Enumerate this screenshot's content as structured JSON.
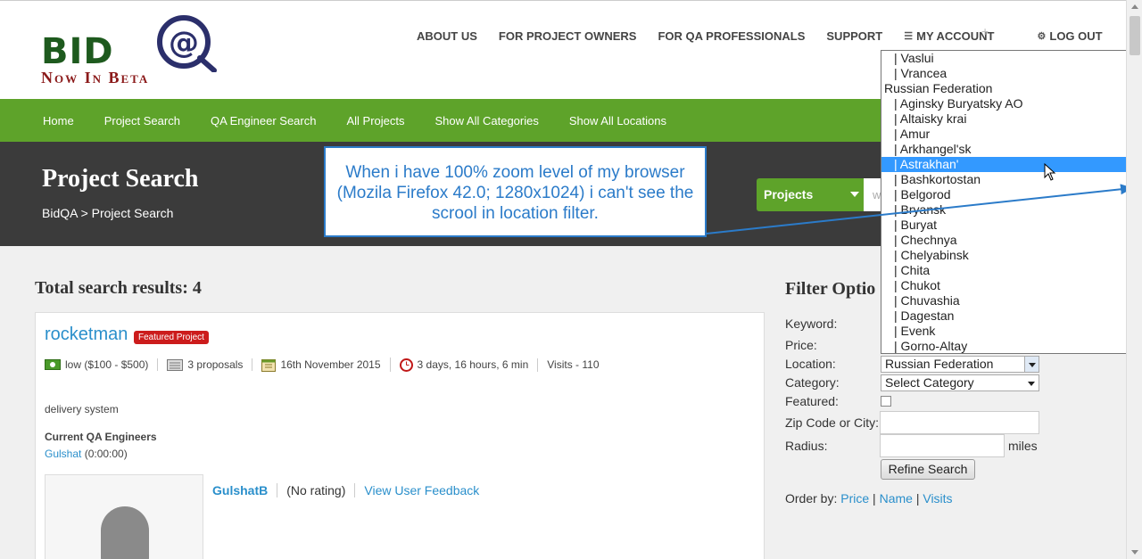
{
  "logo": {
    "main": "BID",
    "at": "@",
    "tagline": "Now In Beta"
  },
  "topnav": {
    "about": "ABOUT US",
    "owners": "FOR PROJECT OWNERS",
    "qa": "FOR QA PROFESSIONALS",
    "support": "SUPPORT",
    "account": "MY ACCOUNT",
    "logout": "LOG OUT",
    "plus": "+"
  },
  "mainnav": [
    "Home",
    "Project Search",
    "QA Engineer Search",
    "All Projects",
    "Show All Categories",
    "Show All Locations"
  ],
  "hero": {
    "title": "Project Search",
    "breadcrumb": "BidQA > Project Search",
    "search_type": "Projects",
    "search_placeholder": "w"
  },
  "annotation": {
    "text": "When i have 100% zoom level of my browser (Mozila Firefox 42.0; 1280x1024) i can't see the scrool in location filter."
  },
  "results": {
    "title": "Total search results: 4",
    "project": {
      "name": "rocketman",
      "badge": "Featured Project",
      "budget": "low ($100 - $500)",
      "proposals": "3 proposals",
      "date": "16th November 2015",
      "time_left": "3 days, 16 hours, 6 min",
      "visits": "Visits - 110",
      "description": "delivery system",
      "engineers_heading": "Current QA Engineers",
      "engineer_name": "Gulshat",
      "engineer_time": " (0:00:00)",
      "user": "GulshatB",
      "rating": "(No rating)",
      "feedback": "View User Feedback"
    }
  },
  "filter": {
    "title": "Filter Optio",
    "keyword": "Keyword:",
    "price": "Price:",
    "location": "Location:",
    "location_value": "Russian Federation",
    "category": "Category:",
    "category_value": "Select Category",
    "featured": "Featured:",
    "zip": "Zip Code or City:",
    "radius": "Radius:",
    "miles": "miles",
    "refine": "Refine Search",
    "order_label": "Order by: ",
    "order_price": "Price",
    "order_name": "Name",
    "order_visits": "Visits",
    "sep": " | "
  },
  "location_dropdown": [
    {
      "label": "|  Vaslui",
      "sub": true
    },
    {
      "label": "|  Vrancea",
      "sub": true
    },
    {
      "label": "Russian Federation",
      "sub": false
    },
    {
      "label": "|  Aginsky Buryatsky AO",
      "sub": true
    },
    {
      "label": "|  Altaisky krai",
      "sub": true
    },
    {
      "label": "|  Amur",
      "sub": true
    },
    {
      "label": "|  Arkhangel'sk",
      "sub": true
    },
    {
      "label": "|  Astrakhan'",
      "sub": true,
      "selected": true
    },
    {
      "label": "|  Bashkortostan",
      "sub": true
    },
    {
      "label": "|  Belgorod",
      "sub": true
    },
    {
      "label": "|  Bryansk",
      "sub": true
    },
    {
      "label": "|  Buryat",
      "sub": true
    },
    {
      "label": "|  Chechnya",
      "sub": true
    },
    {
      "label": "|  Chelyabinsk",
      "sub": true
    },
    {
      "label": "|  Chita",
      "sub": true
    },
    {
      "label": "|  Chukot",
      "sub": true
    },
    {
      "label": "|  Chuvashia",
      "sub": true
    },
    {
      "label": "|  Dagestan",
      "sub": true
    },
    {
      "label": "|  Evenk",
      "sub": true
    },
    {
      "label": "|  Gorno-Altay",
      "sub": true
    }
  ],
  "colors": {
    "green": "#5ea32a",
    "dark": "#3b3b3b",
    "link": "#2a8fcb",
    "badge": "#cc1c1c",
    "highlight": "#3399ff"
  }
}
